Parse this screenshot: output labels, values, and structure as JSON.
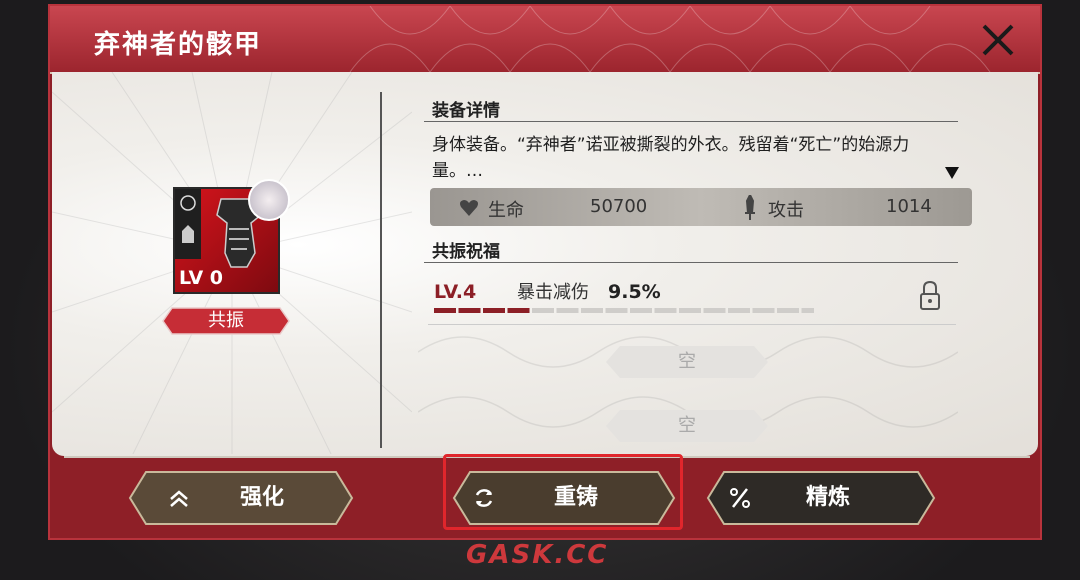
{
  "dialog": {
    "title": "弃神者的骸甲"
  },
  "equipment": {
    "level": "LV 0",
    "resonate_label": "共振"
  },
  "details": {
    "section_title": "装备详情",
    "description": "身体装备。“弃神者”诺亚被撕裂的外衣。残留着“死亡”的始源力量。…",
    "stats": [
      {
        "icon": "heart-icon",
        "label": "生命",
        "value": "50700"
      },
      {
        "icon": "sword-icon",
        "label": "攻击",
        "value": "1014"
      }
    ]
  },
  "blessing": {
    "section_title": "共振祝福",
    "level": "LV.4",
    "effect_name": "暴击减伤",
    "effect_value": "9.5%",
    "progress_filled": 4,
    "progress_total": 16,
    "empty_slots": [
      "空",
      "空"
    ]
  },
  "actions": [
    {
      "icon": "chevrons-up-icon",
      "label": "强化"
    },
    {
      "icon": "refresh-icon",
      "label": "重铸"
    },
    {
      "icon": "percent-icon",
      "label": "精炼"
    }
  ],
  "watermark": "GASK.CC",
  "colors": {
    "header_red": "#9c252e",
    "accent_red": "#8c1f26",
    "button_brown": "#5a4a38",
    "highlight": "#e0262c"
  }
}
